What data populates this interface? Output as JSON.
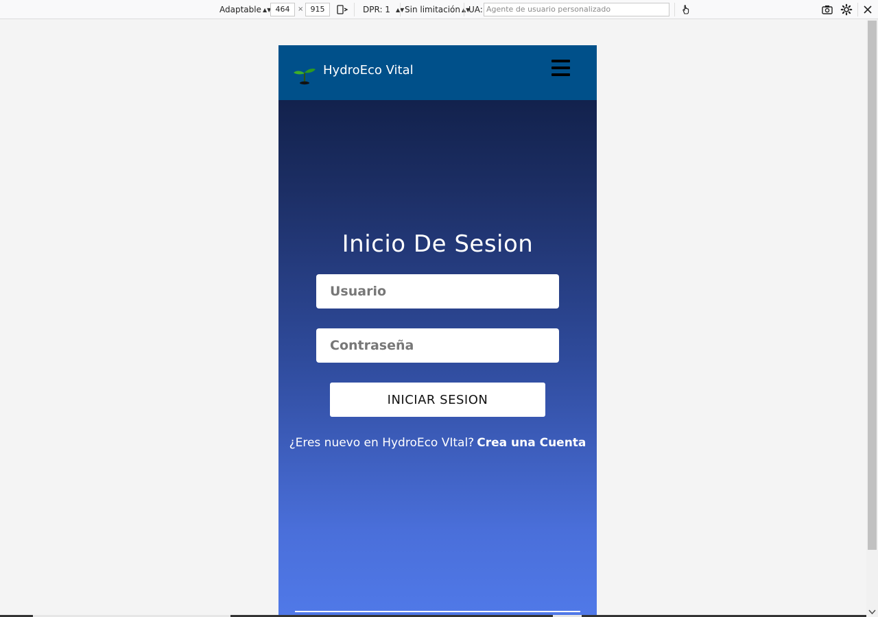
{
  "devtools": {
    "mode_label": "Adaptable",
    "width_value": "464",
    "times_sign": "×",
    "height_value": "915",
    "dpr_label": "DPR: 1",
    "throttle_label": "Sin limitación",
    "ua_label": "UA:",
    "ua_placeholder": "Agente de usuario personalizado",
    "icons": [
      "rotate-icon",
      "touch-icon",
      "screenshot-icon",
      "settings-icon",
      "close-icon"
    ]
  },
  "page": {
    "brand": {
      "name": "HydroEco Vital",
      "logo_icon": "sprout-icon"
    },
    "menu_icon": "hamburger-menu-icon",
    "login": {
      "title": "Inicio De Sesion",
      "username_placeholder": "Usuario",
      "password_placeholder": "Contraseña",
      "submit_label": "INICIAR SESION",
      "signup_prompt": "¿Eres nuevo en HydroEco VItal?",
      "signup_link": "Crea una Cuenta"
    },
    "colors": {
      "navbar": "#00508a",
      "gradient_top": "#0c1a3e",
      "gradient_bottom": "#5079e8"
    }
  }
}
